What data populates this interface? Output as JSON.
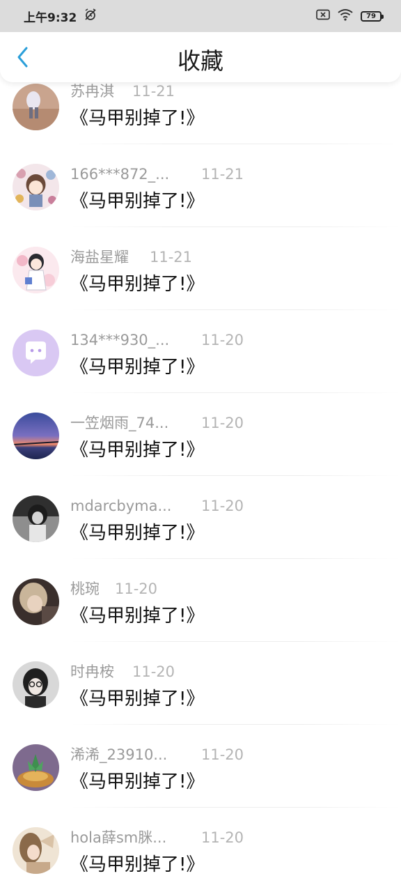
{
  "status_bar": {
    "time": "上午9:32",
    "battery": "79"
  },
  "header": {
    "title": "收藏"
  },
  "items": [
    {
      "name": "苏冉淇",
      "date": "11-21",
      "comment": "《马甲别掉了!》"
    },
    {
      "name": "166***872_...",
      "date": "11-21",
      "comment": "《马甲别掉了!》"
    },
    {
      "name": "海盐星耀",
      "date": "11-21",
      "comment": "《马甲别掉了!》"
    },
    {
      "name": "134***930_...",
      "date": "11-20",
      "comment": "《马甲别掉了!》"
    },
    {
      "name": "一笠烟雨_74...",
      "date": "11-20",
      "comment": "《马甲别掉了!》"
    },
    {
      "name": "mdarcbyma...",
      "date": "11-20",
      "comment": "《马甲别掉了!》"
    },
    {
      "name": "桃琬",
      "date": "11-20",
      "comment": "《马甲别掉了!》"
    },
    {
      "name": "时冉桉",
      "date": "11-20",
      "comment": "《马甲别掉了!》"
    },
    {
      "name": "浠浠_23910...",
      "date": "11-20",
      "comment": "《马甲别掉了!》"
    },
    {
      "name": "hola薛sm脒...",
      "date": "11-20",
      "comment": "《马甲别掉了!》"
    }
  ],
  "colors": {
    "accent": "#2b9fd9",
    "name_text": "#9a9a9a",
    "date_text": "#b4b4b4",
    "comment_text": "#111111",
    "status_bar_bg": "#dcdcdc"
  }
}
